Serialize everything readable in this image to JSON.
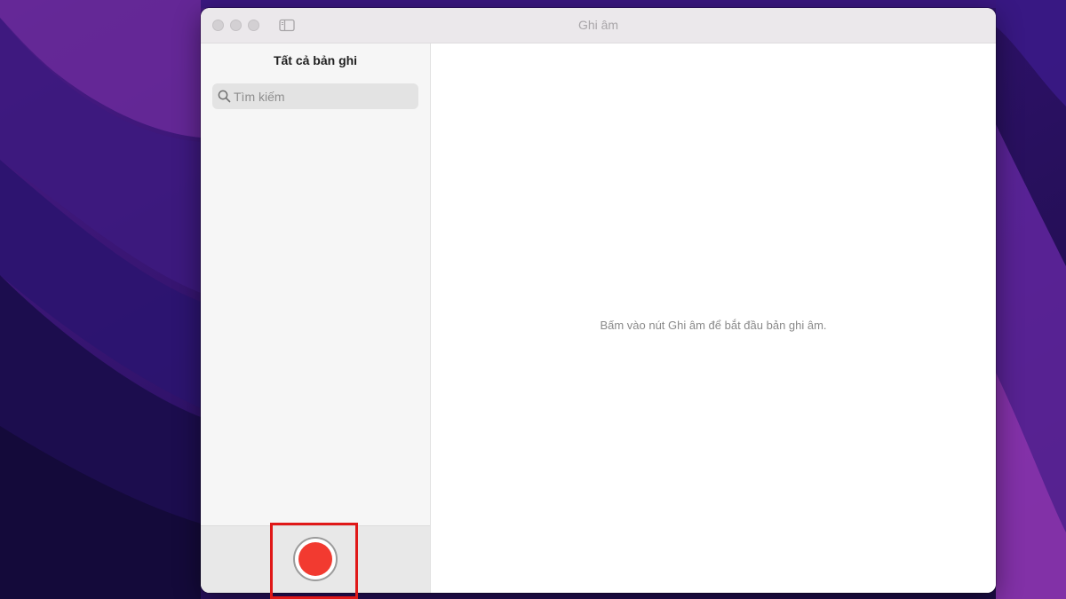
{
  "app": {
    "title": "Ghi âm"
  },
  "sidebar": {
    "title": "Tất cả bản ghi",
    "search": {
      "placeholder": "Tìm kiếm",
      "value": ""
    }
  },
  "main": {
    "empty_message": "Bấm vào nút Ghi âm để bắt đầu bản ghi âm."
  },
  "icons": {
    "window_controls": [
      "close-icon",
      "minimize-icon",
      "zoom-icon"
    ],
    "toolbar": [
      "sidebar-toggle-icon"
    ],
    "search": "search-icon",
    "record": "record-icon"
  },
  "colors": {
    "record_red": "#f23a30",
    "highlight_red": "#e01818",
    "wallpaper_purple": "#2a0f5c"
  }
}
